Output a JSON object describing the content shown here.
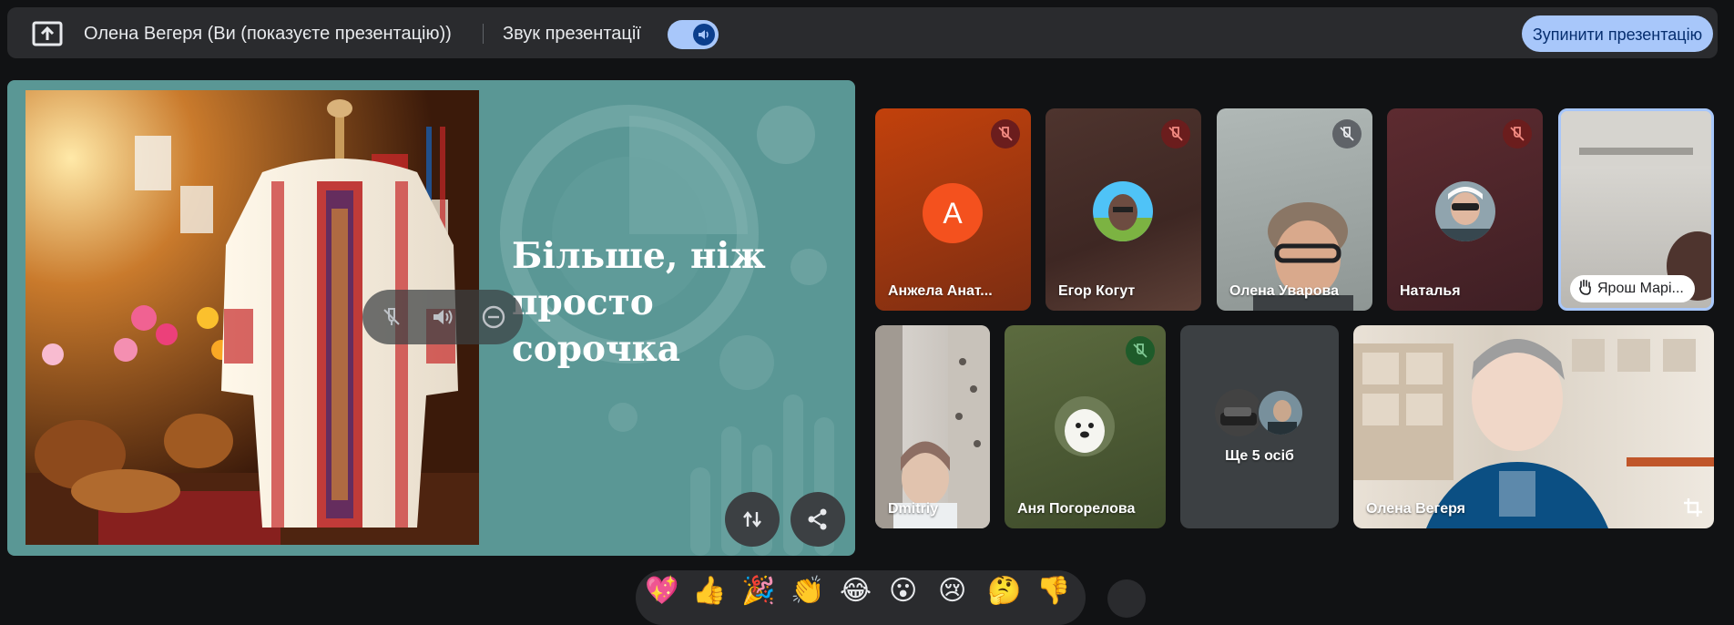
{
  "topbar": {
    "presenter_title": "Олена Вегеря (Ви (показуєте презентацію))",
    "sound_label": "Звук презентації",
    "stop_label": "Зупинити презентацію",
    "sound_toggle_on": true
  },
  "presentation": {
    "slide_title": "Більше, ніж просто сорочка"
  },
  "participants": [
    {
      "name": "Анжела Анат...",
      "avatar_letter": "А"
    },
    {
      "name": "Егор Когут"
    },
    {
      "name": "Олена Уварова"
    },
    {
      "name": "Наталья"
    },
    {
      "name": "Ярош Марі..."
    },
    {
      "name": "Dmitriy"
    },
    {
      "name": "Аня Погорелова"
    },
    {
      "name": "Ще 5 осіб"
    },
    {
      "name": "Олена Вегеря"
    }
  ],
  "reactions": [
    "💖",
    "👍",
    "🎉",
    "👏",
    "😂",
    "😮",
    "😢",
    "🤔",
    "👎"
  ],
  "colors": {
    "accent": "#a8c7fa",
    "slide_bg": "#5a9795",
    "avatar_orange": "#f4511e",
    "muted_red": "#8b1f1f"
  }
}
